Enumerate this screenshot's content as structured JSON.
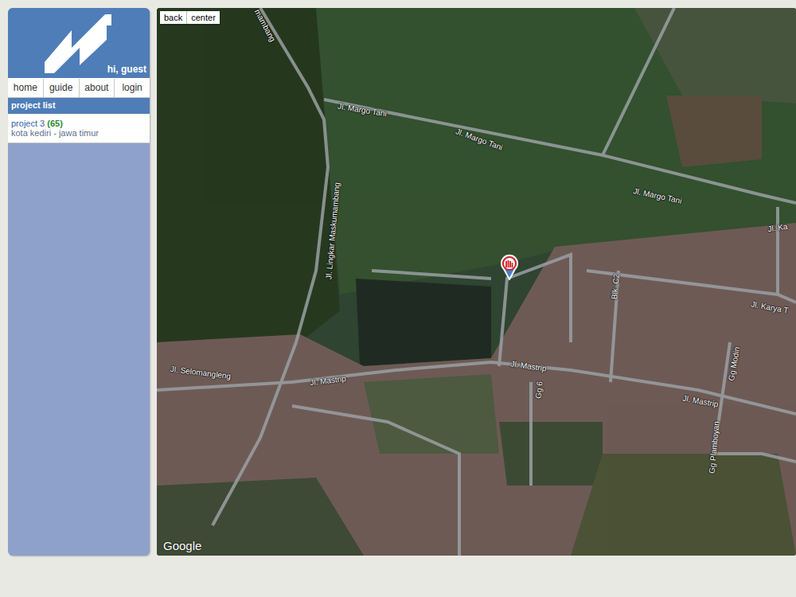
{
  "sidebar": {
    "greeting": "hi, guest",
    "nav": [
      {
        "label": "home"
      },
      {
        "label": "guide"
      },
      {
        "label": "about"
      },
      {
        "label": "login"
      }
    ],
    "section_title": "project list",
    "projects": [
      {
        "name": "project 3",
        "count": "(65)",
        "location": "kota kediri - jawa timur"
      }
    ]
  },
  "map": {
    "controls": [
      "back",
      "center"
    ],
    "labels": [
      "mambang",
      "Jl. Margo Tani",
      "Jl. Margo Tani",
      "Jl. Margo Tani",
      "Jl. Lingkar Maskumambang",
      "Jl. Ka",
      "Blk. C2",
      "Jl. Karya T",
      "Jl. Selomangleng",
      "Jl. Mastrip",
      "Jl. Mastrip",
      "Jl. Mastrip",
      "Gg 6",
      "Gg Modin",
      "Gg Plamboyan"
    ],
    "attribution": "Google"
  }
}
